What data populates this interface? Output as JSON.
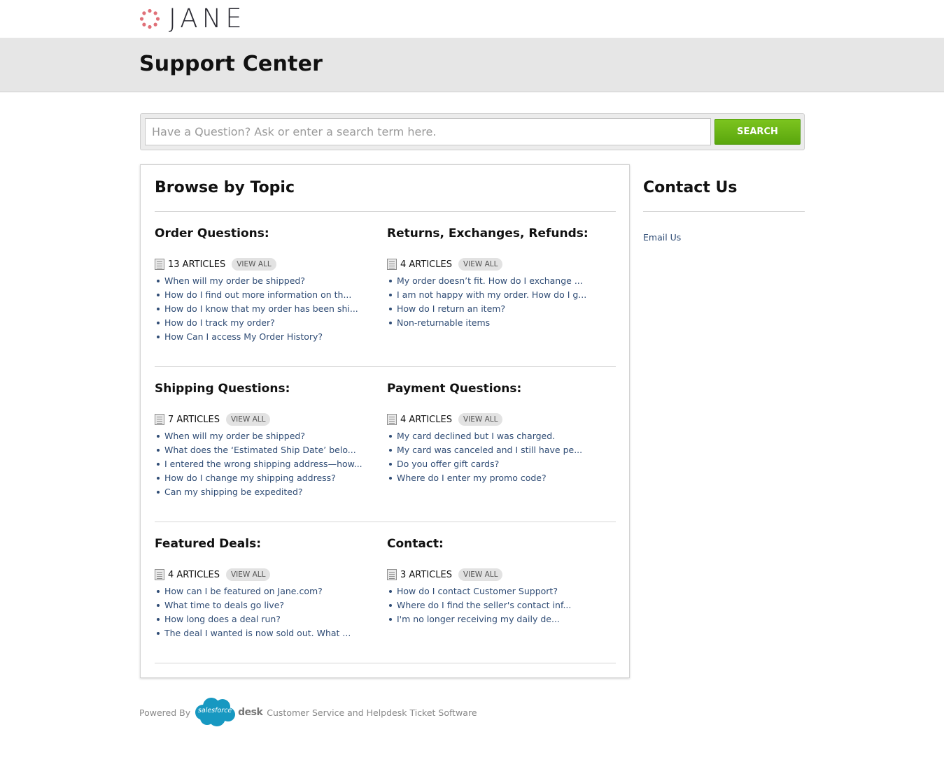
{
  "brand": {
    "name": "JANE",
    "logo_color": "#e07078"
  },
  "header": {
    "title": "Support Center"
  },
  "search": {
    "placeholder": "Have a Question? Ask or enter a search term here.",
    "button_label": "SEARCH",
    "button_color": "#68b316"
  },
  "browse": {
    "title": "Browse by Topic",
    "topics": [
      {
        "title": "Order Questions:",
        "count": "13 ARTICLES",
        "view_all": "VIEW ALL",
        "articles": [
          "When will my order be shipped?",
          "How do I find out more information on th...",
          "How do I know that my order has been shi...",
          "How do I track my order?",
          "How Can I access My Order History?"
        ]
      },
      {
        "title": "Returns, Exchanges, Refunds:",
        "count": "4 ARTICLES",
        "view_all": "VIEW ALL",
        "articles": [
          "My order doesn’t fit. How do I exchange ...",
          "I am not happy with my order. How do I g...",
          "How do I return an item?",
          "Non-returnable items"
        ]
      },
      {
        "title": "Shipping Questions:",
        "count": "7 ARTICLES",
        "view_all": "VIEW ALL",
        "articles": [
          "When will my order be shipped?",
          "What does the ‘Estimated Ship Date’ belo...",
          "I entered the wrong shipping address—how...",
          "How do I change my shipping address?",
          "Can my shipping be expedited?"
        ]
      },
      {
        "title": "Payment Questions:",
        "count": "4 ARTICLES",
        "view_all": "VIEW ALL",
        "articles": [
          "My card declined but I was charged.",
          "My card was canceled and I still have pe...",
          "Do you offer gift cards?",
          "Where do I enter my promo code?"
        ]
      },
      {
        "title": "Featured Deals:",
        "count": "4 ARTICLES",
        "view_all": "VIEW ALL",
        "articles": [
          "How can I be featured on Jane.com?",
          "What time to deals go live?",
          "How long does a deal run?",
          "The deal I wanted is now sold out. What ..."
        ]
      },
      {
        "title": "Contact:",
        "count": "3 ARTICLES",
        "view_all": "VIEW ALL",
        "articles": [
          "How do I contact Customer Support?",
          "Where do I find the seller's contact inf...",
          "I'm no longer receiving my daily de..."
        ]
      }
    ]
  },
  "contact": {
    "title": "Contact Us",
    "email_link": "Email Us"
  },
  "footer": {
    "powered_by": "Powered By",
    "salesforce": "salesforce",
    "desk": "desk",
    "tagline": "Customer Service and Helpdesk Ticket Software",
    "salesforce_color": "#1798c1"
  }
}
